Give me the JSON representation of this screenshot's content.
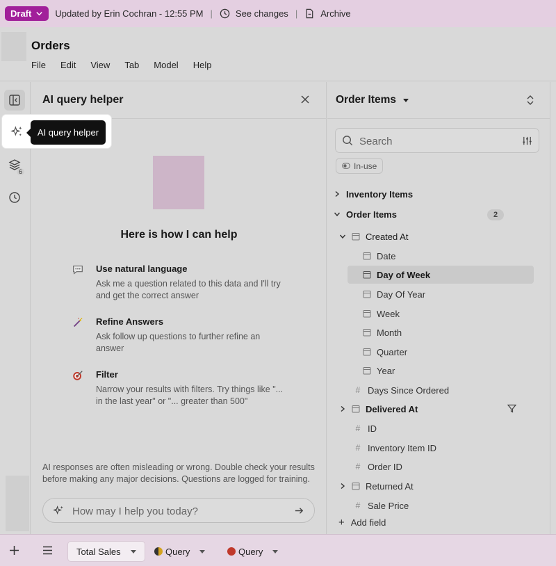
{
  "topbar": {
    "status": "Draft",
    "updated_text": "Updated by Erin Cochran - 12:55 PM",
    "see_changes": "See changes",
    "archive": "Archive",
    "accent_color": "#a11f9a"
  },
  "header": {
    "title": "Orders",
    "menu": [
      "File",
      "Edit",
      "View",
      "Tab",
      "Model",
      "Help"
    ]
  },
  "rail": {
    "layers_badge": "6",
    "tooltip": "AI query helper"
  },
  "ai_panel": {
    "title": "AI query helper",
    "help_heading": "Here is how I can help",
    "features": [
      {
        "icon": "speech-bubble-icon",
        "title": "Use natural language",
        "description": "Ask me a question related to this data and I'll try and get the correct answer"
      },
      {
        "icon": "magic-wand-icon",
        "title": "Refine Answers",
        "description": "Ask follow up questions to further refine an answer"
      },
      {
        "icon": "target-icon",
        "title": "Filter",
        "description": "Narrow your results with filters. Try things like \"... in the last year\" or \"... greater than 500\""
      }
    ],
    "disclaimer": "AI responses are often misleading or wrong. Double check your results before making any major decisions. Questions are logged for training.",
    "input_placeholder": "How may I help you today?"
  },
  "fields_panel": {
    "title": "Order Items",
    "search_placeholder": "Search",
    "in_use": "In-use",
    "groups": [
      {
        "label": "Inventory Items",
        "expanded": false
      },
      {
        "label": "Order Items",
        "expanded": true,
        "count": "2"
      }
    ],
    "tree": [
      {
        "label": "Created At",
        "type": "date",
        "expanded": true
      },
      {
        "label": "Date",
        "type": "date"
      },
      {
        "label": "Day of Week",
        "type": "date",
        "selected": true
      },
      {
        "label": "Day Of Year",
        "type": "date"
      },
      {
        "label": "Week",
        "type": "date"
      },
      {
        "label": "Month",
        "type": "date"
      },
      {
        "label": "Quarter",
        "type": "date"
      },
      {
        "label": "Year",
        "type": "date"
      },
      {
        "label": "Days Since Ordered",
        "type": "number"
      },
      {
        "label": "Delivered At",
        "type": "date",
        "collapsed": true,
        "filtered": true
      },
      {
        "label": "ID",
        "type": "number"
      },
      {
        "label": "Inventory Item ID",
        "type": "number"
      },
      {
        "label": "Order ID",
        "type": "number"
      },
      {
        "label": "Returned At",
        "type": "date",
        "collapsed": true
      },
      {
        "label": "Sale Price",
        "type": "number"
      }
    ],
    "add_field": "Add field"
  },
  "bottom_tabs": [
    {
      "label": "Total Sales",
      "active": true
    },
    {
      "label": "Query",
      "dot_color": "#c9a227"
    },
    {
      "label": "Query",
      "dot_color": "#c0392b"
    }
  ]
}
